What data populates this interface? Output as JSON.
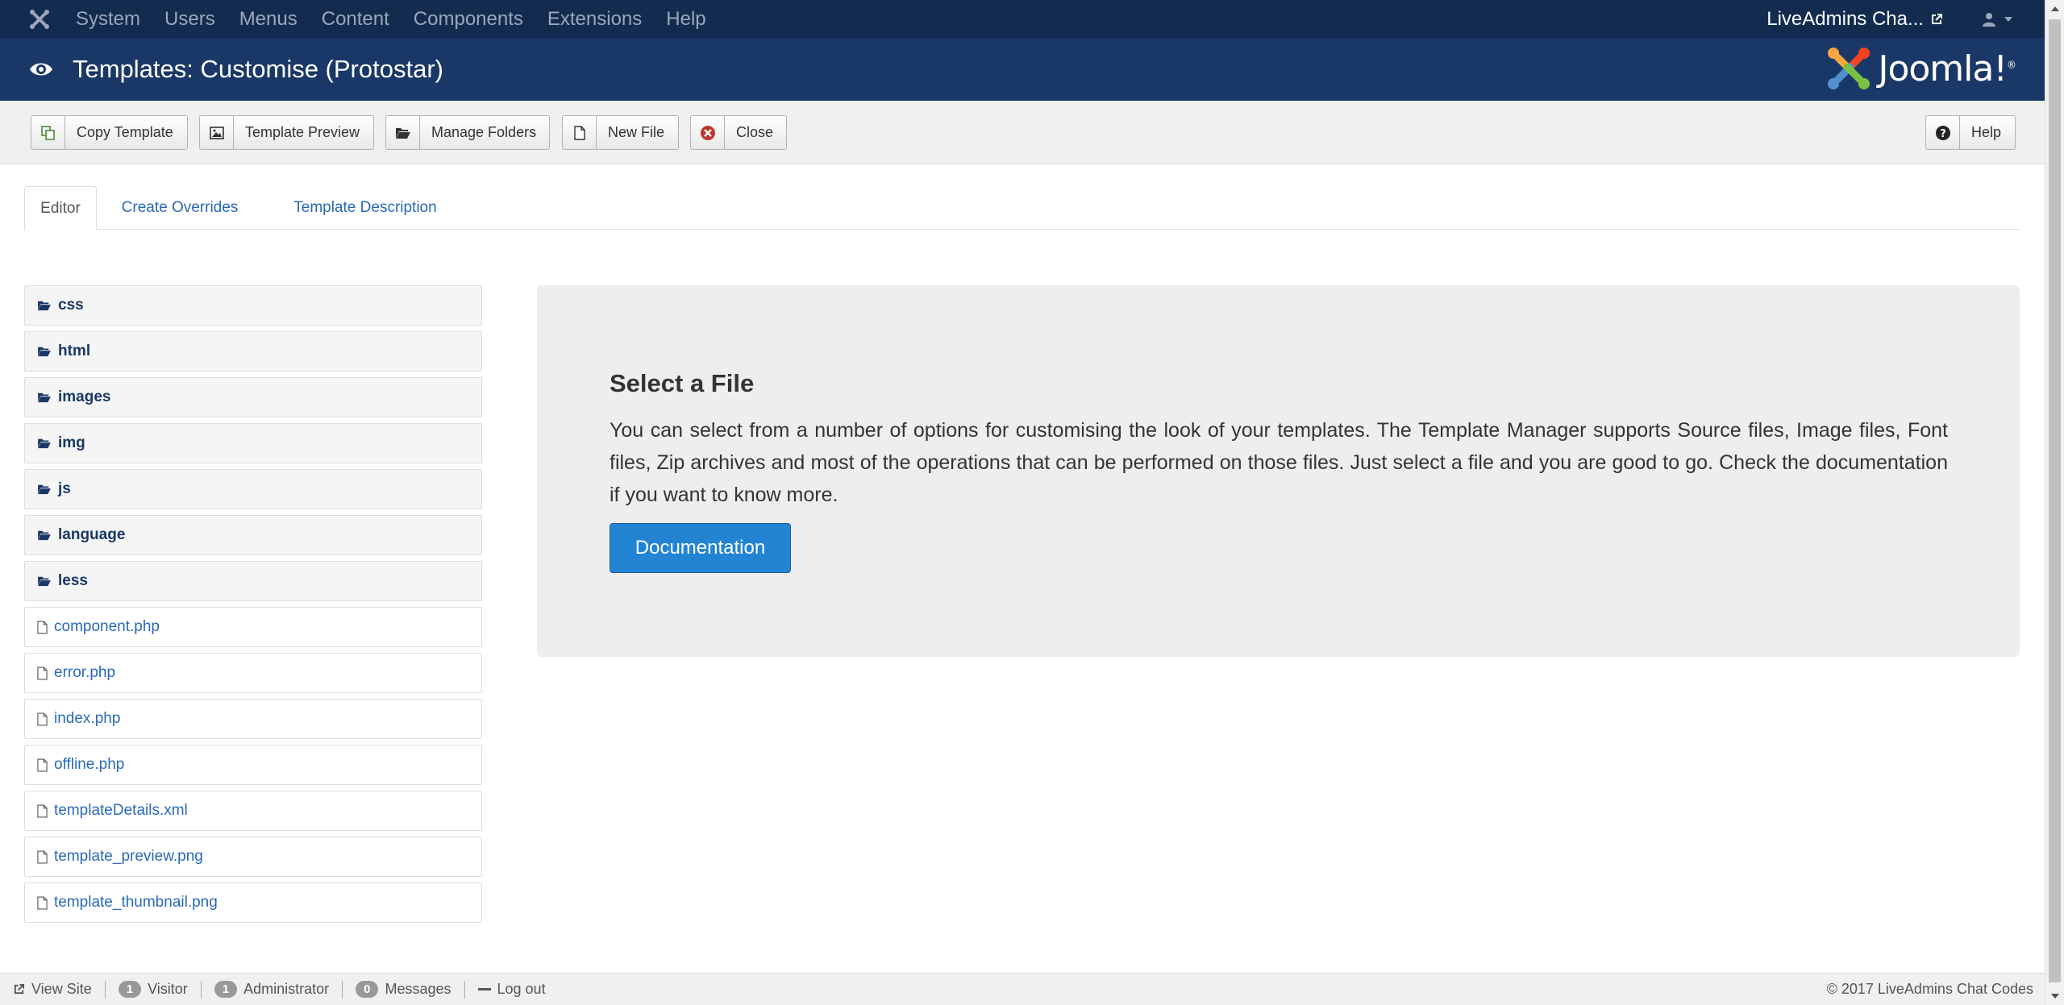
{
  "navbar": {
    "menu": [
      "System",
      "Users",
      "Menus",
      "Content",
      "Components",
      "Extensions",
      "Help"
    ],
    "site_name": "LiveAdmins Cha...",
    "icons": [
      "joomla-icon",
      "external-link-icon",
      "user-icon",
      "caret-down-icon"
    ]
  },
  "header": {
    "title": "Templates: Customise (Protostar)",
    "logo_text": "Joomla!",
    "logo_trademark": "®"
  },
  "toolbar": {
    "copy_template": "Copy Template",
    "template_preview": "Template Preview",
    "manage_folders": "Manage Folders",
    "new_file": "New File",
    "close": "Close",
    "help": "Help"
  },
  "tabs": [
    "Editor",
    "Create Overrides",
    "Template Description"
  ],
  "tree": {
    "folders": [
      "css",
      "html",
      "images",
      "img",
      "js",
      "language",
      "less"
    ],
    "files": [
      "component.php",
      "error.php",
      "index.php",
      "offline.php",
      "templateDetails.xml",
      "template_preview.png",
      "template_thumbnail.png"
    ]
  },
  "panel": {
    "title": "Select a File",
    "text": "You can select from a number of options for customising the look of your templates. The Template Manager supports Source files, Image files, Font files, Zip archives and most of the operations that can be performed on those files. Just select a file and you are good to go. Check the documentation if you want to know more.",
    "button": "Documentation"
  },
  "statusbar": {
    "view_site": "View Site",
    "visitor_count": "1",
    "visitor_label": "Visitor",
    "admin_count": "1",
    "admin_label": "Administrator",
    "messages_count": "0",
    "messages_label": "Messages",
    "logout": "Log out",
    "copyright": "© 2017 LiveAdmins Chat Codes"
  },
  "colors": {
    "navbar": "#132b4f",
    "header": "#1a3867",
    "link": "#2a69b8",
    "primary_button": "#2384d3",
    "close_icon": "#bd362f"
  }
}
